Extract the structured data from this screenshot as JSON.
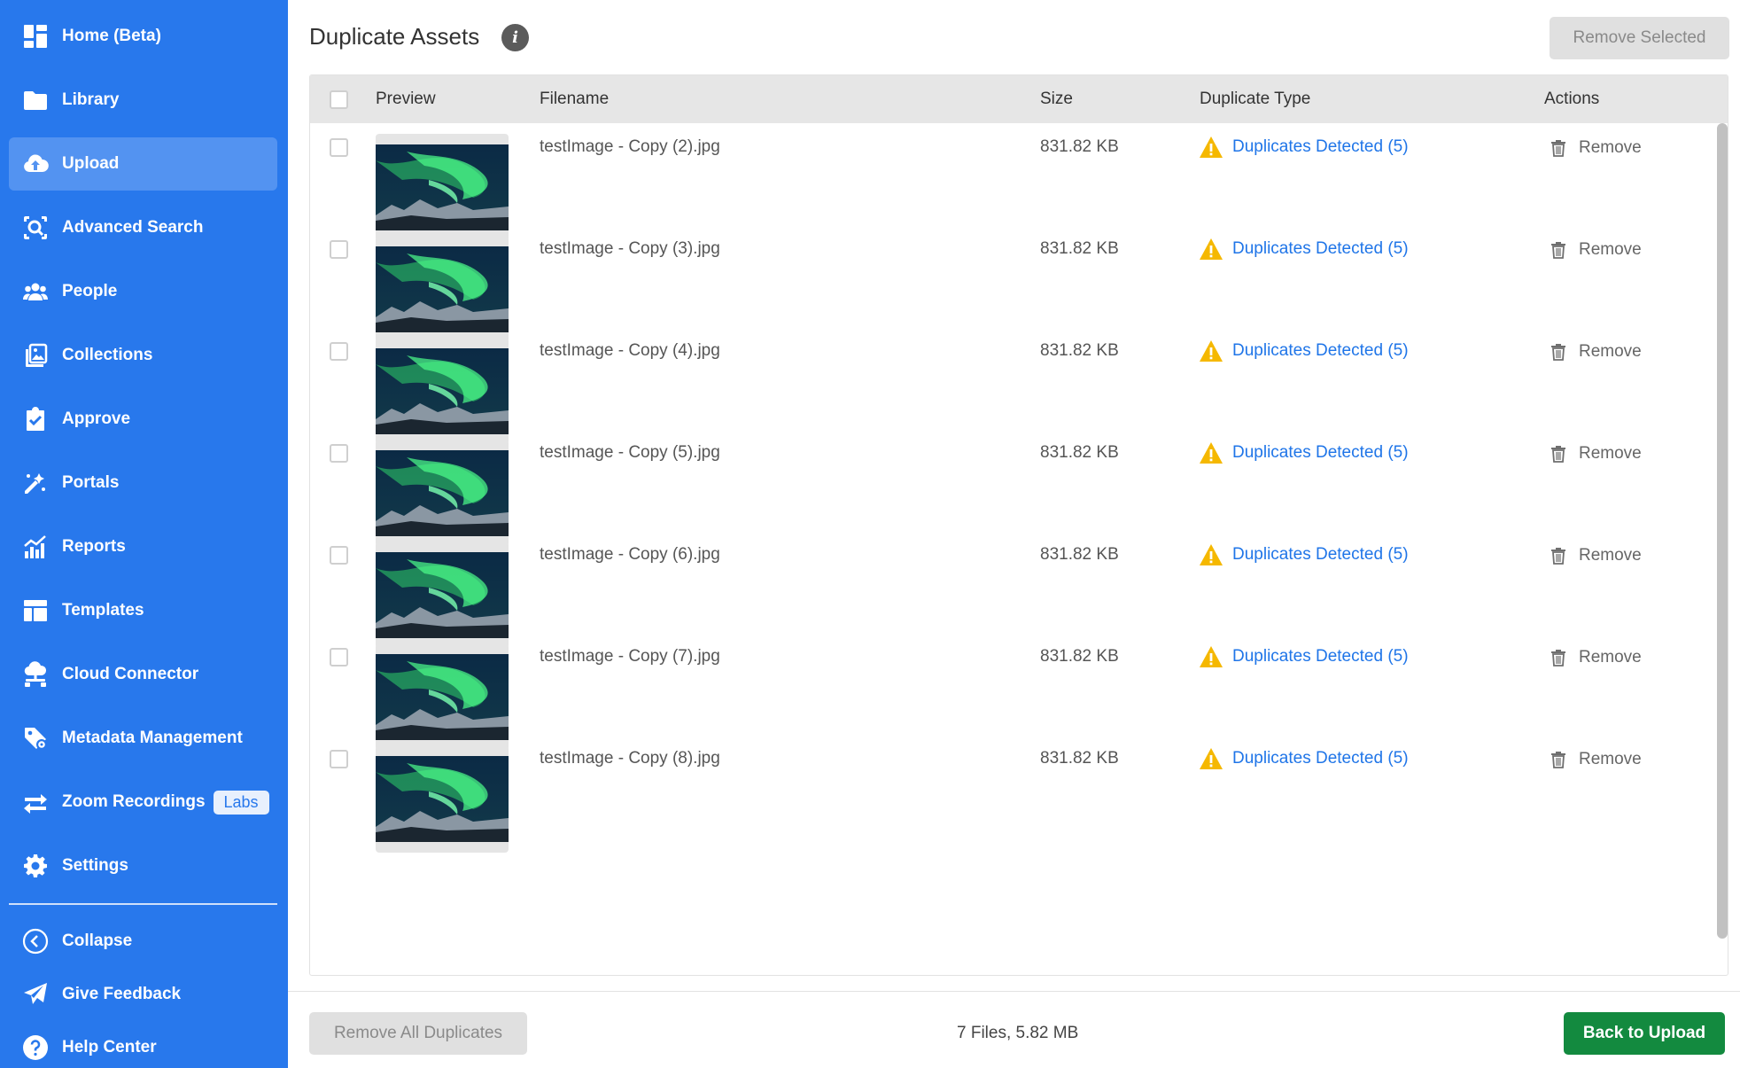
{
  "sidebar": {
    "items": [
      {
        "label": "Home (Beta)",
        "icon": "dashboard-icon"
      },
      {
        "label": "Library",
        "icon": "folder-icon"
      },
      {
        "label": "Upload",
        "icon": "cloud-upload-icon",
        "active": true
      },
      {
        "label": "Advanced Search",
        "icon": "search-icon"
      },
      {
        "label": "People",
        "icon": "people-icon"
      },
      {
        "label": "Collections",
        "icon": "collections-icon"
      },
      {
        "label": "Approve",
        "icon": "clipboard-check-icon"
      },
      {
        "label": "Portals",
        "icon": "portals-icon"
      },
      {
        "label": "Reports",
        "icon": "reports-chart-icon"
      },
      {
        "label": "Templates",
        "icon": "templates-icon"
      },
      {
        "label": "Cloud Connector",
        "icon": "cloud-connector-icon"
      },
      {
        "label": "Metadata Management",
        "icon": "metadata-tag-icon"
      },
      {
        "label": "Zoom Recordings",
        "icon": "swap-arrows-icon",
        "badge": "Labs"
      },
      {
        "label": "Settings",
        "icon": "gear-icon"
      }
    ],
    "collapse_label": "Collapse",
    "feedback_label": "Give Feedback",
    "help_label": "Help Center"
  },
  "header": {
    "title": "Duplicate Assets",
    "remove_selected_label": "Remove Selected"
  },
  "table": {
    "columns": [
      "Preview",
      "Filename",
      "Size",
      "Duplicate Type",
      "Actions"
    ],
    "rows": [
      {
        "filename": "testImage - Copy (2).jpg",
        "size": "831.82 KB",
        "duplicate_type": "Duplicates Detected (5)",
        "action": "Remove"
      },
      {
        "filename": "testImage - Copy (3).jpg",
        "size": "831.82 KB",
        "duplicate_type": "Duplicates Detected (5)",
        "action": "Remove"
      },
      {
        "filename": "testImage - Copy (4).jpg",
        "size": "831.82 KB",
        "duplicate_type": "Duplicates Detected (5)",
        "action": "Remove"
      },
      {
        "filename": "testImage - Copy (5).jpg",
        "size": "831.82 KB",
        "duplicate_type": "Duplicates Detected (5)",
        "action": "Remove"
      },
      {
        "filename": "testImage - Copy (6).jpg",
        "size": "831.82 KB",
        "duplicate_type": "Duplicates Detected (5)",
        "action": "Remove"
      },
      {
        "filename": "testImage - Copy (7).jpg",
        "size": "831.82 KB",
        "duplicate_type": "Duplicates Detected (5)",
        "action": "Remove"
      },
      {
        "filename": "testImage - Copy (8).jpg",
        "size": "831.82 KB",
        "duplicate_type": "Duplicates Detected (5)",
        "action": "Remove"
      }
    ]
  },
  "footer": {
    "remove_all_label": "Remove All Duplicates",
    "summary": "7 Files, 5.82 MB",
    "back_label": "Back to Upload"
  },
  "colors": {
    "sidebar_bg": "#2878ec",
    "sidebar_active": "#5393f1",
    "link_blue": "#1f75e8",
    "warning_yellow": "#f5b800",
    "primary_green": "#138a3f"
  }
}
